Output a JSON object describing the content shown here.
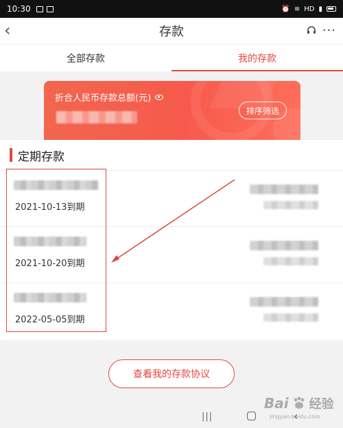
{
  "status_bar": {
    "time": "10:30",
    "network": "HD"
  },
  "header": {
    "title": "存款"
  },
  "tabs": [
    {
      "label": "全部存款",
      "active": false
    },
    {
      "label": "我的存款",
      "active": true
    }
  ],
  "summary_card": {
    "label": "折合人民币存款总额(元)",
    "filter_label": "排序筛选"
  },
  "section": {
    "title": "定期存款",
    "items": [
      {
        "maturity": "2021-10-13到期"
      },
      {
        "maturity": "2021-10-20到期"
      },
      {
        "maturity": "2022-05-05到期"
      }
    ]
  },
  "footer": {
    "agreement_label": "查看我的存款协议"
  },
  "watermark": {
    "brand": "Bai",
    "brand_cn": "经验",
    "url": "jingyan.baidu.com"
  },
  "colors": {
    "accent": "#e8453c",
    "card_gradient_start": "#f2664f",
    "card_gradient_end": "#ff6f5b"
  },
  "icons": {
    "back": "back-arrow-icon",
    "headset": "headset-icon",
    "more": "more-icon",
    "eye": "eye-icon"
  }
}
